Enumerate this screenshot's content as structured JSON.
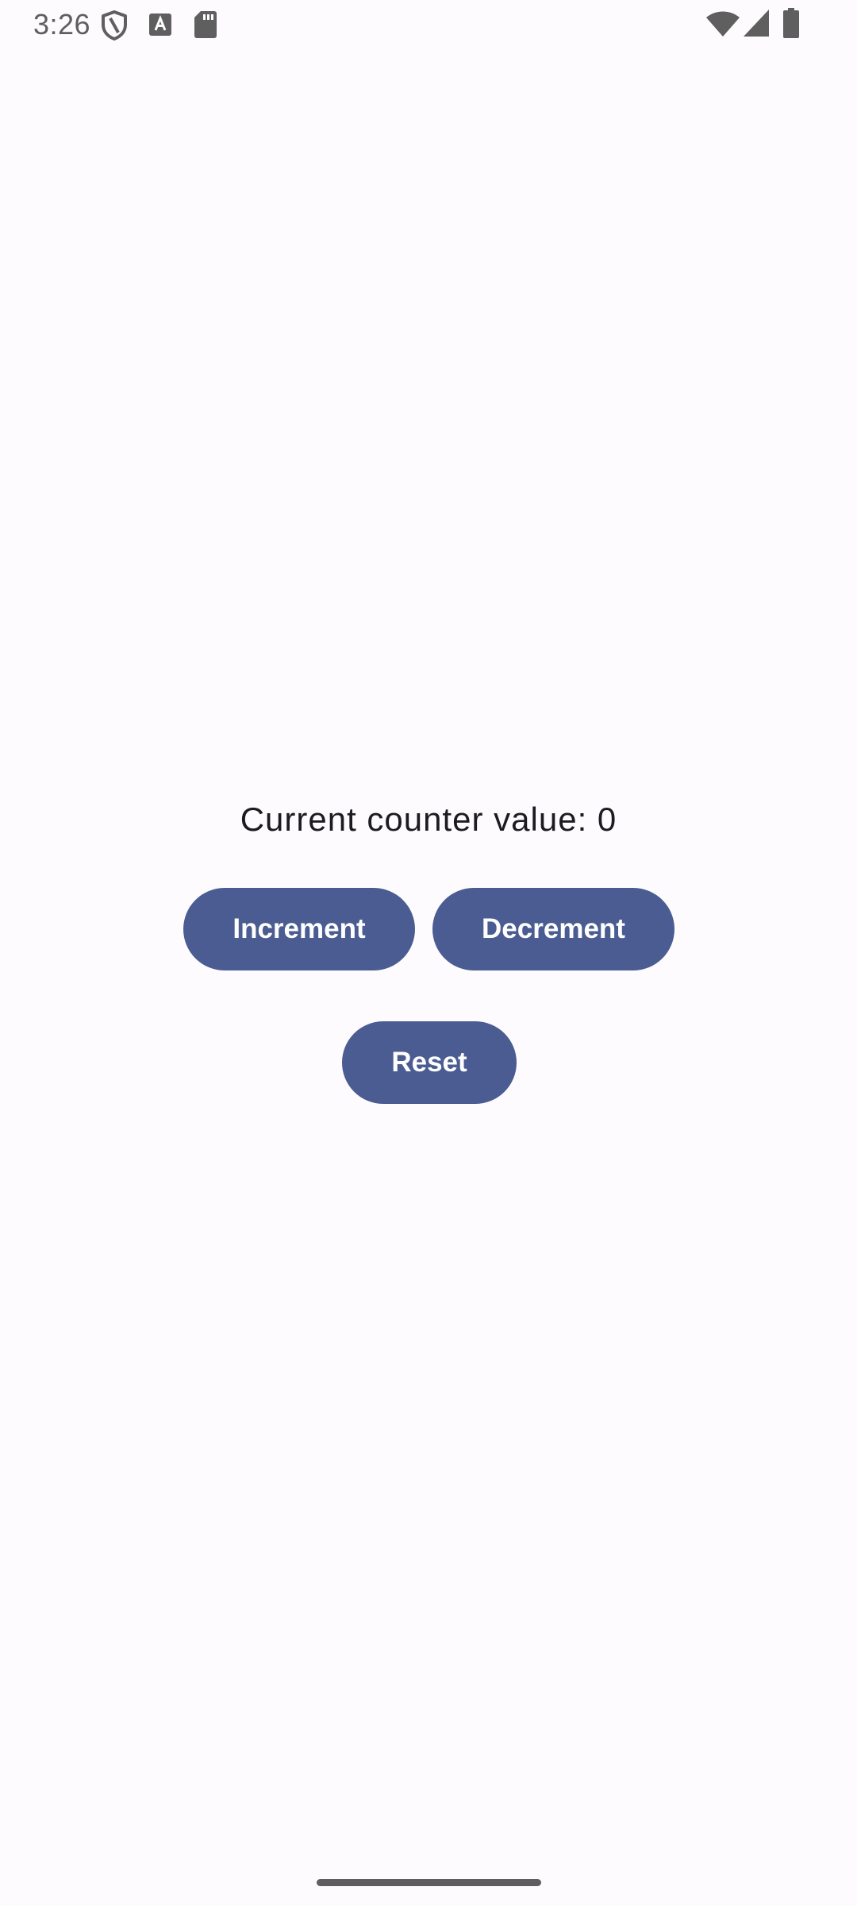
{
  "status_bar": {
    "time": "3:26",
    "left_icons": [
      "shield-icon",
      "text-a-icon",
      "sd-card-icon"
    ],
    "right_icons": [
      "wifi-icon",
      "cell-signal-icon",
      "battery-icon"
    ],
    "icon_color": "#5f5f5f"
  },
  "counter": {
    "label": "Current counter value: 0"
  },
  "buttons": {
    "increment": "Increment",
    "decrement": "Decrement",
    "reset": "Reset"
  },
  "colors": {
    "background": "#fefbfe",
    "button": "#4a5c92",
    "button_text": "#ffffff",
    "text": "#1c1b1f"
  }
}
